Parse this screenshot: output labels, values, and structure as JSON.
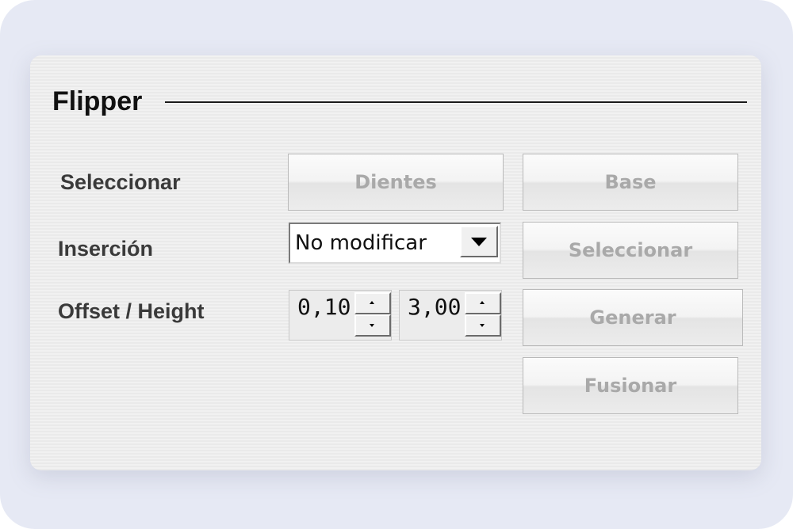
{
  "panel": {
    "title": "Flipper"
  },
  "rows": {
    "select_label": "Seleccionar",
    "insertion_label": "Inserción",
    "offset_height_label": "Offset / Height"
  },
  "buttons": {
    "dientes": "Dientes",
    "base": "Base",
    "seleccionar": "Seleccionar",
    "generar": "Generar",
    "fusionar": "Fusionar"
  },
  "insertion_select": {
    "selected": "No modificar"
  },
  "offset_spinner": {
    "value": "0,10"
  },
  "height_spinner": {
    "value": "3,00"
  },
  "colors": {
    "background": "#e6e9f4",
    "panel": "#efefef",
    "disabled_text": "#a9a9a9",
    "label_text": "#3a3a3a"
  },
  "icons": {
    "dropdown": "triangle-down-icon",
    "spin_up": "small-up-arrow-icon",
    "spin_down": "small-down-arrow-icon"
  }
}
